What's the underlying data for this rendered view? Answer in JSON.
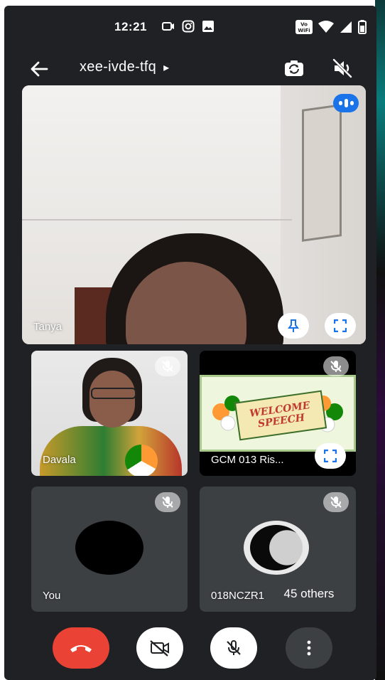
{
  "status_bar": {
    "time": "12:21",
    "left_icons": [
      "screen-record-icon",
      "instagram-icon",
      "gallery-icon"
    ],
    "right_icons": [
      "vowifi-icon",
      "wifi-icon",
      "signal-icon",
      "battery-icon"
    ],
    "vowifi_text": "Vo\nWiFi"
  },
  "header": {
    "meeting_code": "xee-ivde-tfq",
    "code_chevron": "▸"
  },
  "main_tile": {
    "participant_name": "Tanya"
  },
  "tiles": [
    {
      "participant_name": "Davala",
      "muted": true
    },
    {
      "participant_name": "GCM 013 Ris...",
      "muted": true,
      "presentation_text_line1": "WELCOME",
      "presentation_text_line2": "SPEECH"
    },
    {
      "participant_name": "You",
      "muted": true
    },
    {
      "participant_name": "018NCZR1",
      "muted": true
    }
  ],
  "others_label": "45 others",
  "colors": {
    "accent_blue": "#1a73e8",
    "hangup_red": "#ea4335",
    "background": "#202124",
    "tile": "#3c4043"
  }
}
